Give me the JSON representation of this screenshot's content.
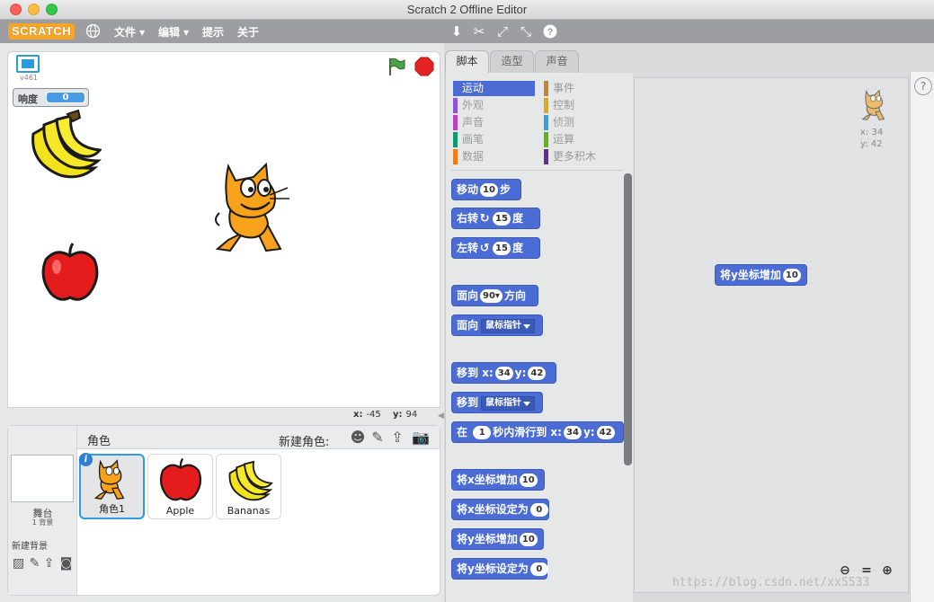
{
  "window": {
    "title": "Scratch 2 Offline Editor"
  },
  "menubar": {
    "logo": "SCRATCH",
    "items": [
      "文件 ▾",
      "编辑 ▾",
      "提示",
      "关于"
    ]
  },
  "stage": {
    "version": "v461",
    "monitor": {
      "label": "响度",
      "value": "0"
    },
    "coords": {
      "x_label": "x:",
      "x_value": "-45",
      "y_label": "y:",
      "y_value": "94"
    }
  },
  "sprites_panel": {
    "header": "角色",
    "new_sprite_label": "新建角色:",
    "stage_name": "舞台",
    "stage_count": "1 背景",
    "new_backdrop_label": "新建背景",
    "sprites": [
      {
        "name": "角色1",
        "selected": true
      },
      {
        "name": "Apple",
        "selected": false
      },
      {
        "name": "Bananas",
        "selected": false
      }
    ]
  },
  "tabs": [
    "脚本",
    "造型",
    "声音"
  ],
  "categories": [
    {
      "label": "运动",
      "color": "#4a6cd4",
      "active": true
    },
    {
      "label": "外观",
      "color": "#8a55d7"
    },
    {
      "label": "声音",
      "color": "#bb42c3"
    },
    {
      "label": "画笔",
      "color": "#0e9a6c"
    },
    {
      "label": "数据",
      "color": "#ee7d16"
    },
    {
      "label": "事件",
      "color": "#c88330"
    },
    {
      "label": "控制",
      "color": "#e1a91a"
    },
    {
      "label": "侦测",
      "color": "#2ca5e2"
    },
    {
      "label": "运算",
      "color": "#5cb712"
    },
    {
      "label": "更多积木",
      "color": "#632d99"
    }
  ],
  "blocks": {
    "move": {
      "label": "移动",
      "value": "10",
      "suffix": "步"
    },
    "turn_right": {
      "label": "右转",
      "value": "15",
      "suffix": "度"
    },
    "turn_left": {
      "label": "左转",
      "value": "15",
      "suffix": "度"
    },
    "point_dir": {
      "label": "面向",
      "value": "90▾",
      "suffix": "方向"
    },
    "point_towards": {
      "label": "面向",
      "dropdown": "鼠标指针"
    },
    "goto_xy": {
      "label": "移到",
      "x_label": "x:",
      "x": "34",
      "y_label": "y:",
      "y": "42"
    },
    "goto_target": {
      "label": "移到",
      "dropdown": "鼠标指针"
    },
    "glide": {
      "label": "在",
      "secs": "1",
      "mid": "秒内滑行到",
      "x_label": "x:",
      "x": "34",
      "y_label": "y:",
      "y": "42"
    },
    "change_x": {
      "label": "将x坐标增加",
      "value": "10"
    },
    "set_x": {
      "label": "将x坐标设定为",
      "value": "0"
    },
    "change_y": {
      "label": "将y坐标增加",
      "value": "10"
    },
    "set_y": {
      "label": "将y坐标设定为",
      "value": "0"
    }
  },
  "script_area": {
    "block": {
      "label": "将y坐标增加",
      "value": "10"
    },
    "sprite_x": "x: 34",
    "sprite_y": "y: 42"
  },
  "watermark": "https://blog.csdn.net/xx5533",
  "icons": {
    "globe": "globe-icon",
    "duplicate": "stamp-icon",
    "delete": "scissors-icon",
    "grow": "grow-icon",
    "shrink": "shrink-icon",
    "help": "help-icon"
  }
}
